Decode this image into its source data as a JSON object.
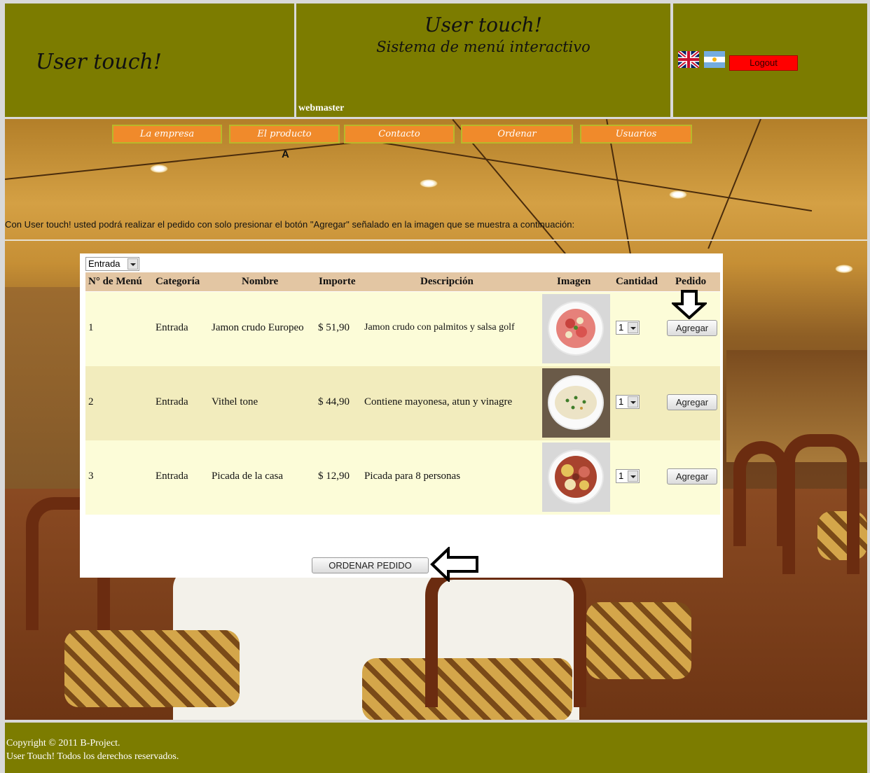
{
  "header": {
    "logo_text": "User touch!",
    "title": "User touch!",
    "subtitle": "Sistema de menú interactivo",
    "username": "webmaster",
    "logout_label": "Logout",
    "languages": [
      "english-flag-icon",
      "argentina-flag-icon"
    ]
  },
  "nav": {
    "items": [
      {
        "label": "La empresa"
      },
      {
        "label": "El producto"
      },
      {
        "label": "Contacto"
      },
      {
        "label": "Ordenar"
      },
      {
        "label": "Usuarios"
      }
    ],
    "marker": "A"
  },
  "intro": "Con User touch! usted podrá realizar el pedido con solo presionar el botón \"Agregar\" señalado en la imagen que se muestra a continuación:",
  "menu": {
    "category_select": "Entrada",
    "columns": [
      "N° de Menú",
      "Categoría",
      "Nombre",
      "Importe",
      "Descripción",
      "Imagen",
      "Cantidad",
      "Pedido"
    ],
    "rows": [
      {
        "num": "1",
        "category": "Entrada",
        "name": "Jamon crudo Europeo",
        "price": "$ 51,90",
        "description": "Jamon crudo con palmitos y salsa golf",
        "image": "jamon-crudo-plate-image",
        "quantity": "1",
        "action": "Agregar"
      },
      {
        "num": "2",
        "category": "Entrada",
        "name": "Vithel tone",
        "price": "$ 44,90",
        "description": "Contiene mayonesa, atun y vinagre",
        "image": "vithel-tone-plate-image",
        "quantity": "1",
        "action": "Agregar"
      },
      {
        "num": "3",
        "category": "Entrada",
        "name": "Picada de la casa",
        "price": "$ 12,90",
        "description": "Picada para 8 personas",
        "image": "picada-plate-image",
        "quantity": "1",
        "action": "Agregar"
      }
    ],
    "order_button": "ORDENAR PEDIDO"
  },
  "footer": {
    "line1": "Copyright © 2011 B-Project.",
    "line2": "User Touch! Todos los derechos reservados."
  },
  "colors": {
    "header_bg": "#7c7c00",
    "nav_bg": "#f08a2b",
    "nav_border": "#b8b82a",
    "logout_bg": "#ff0000",
    "table_header_bg": "#e3c6a3",
    "row_odd_bg": "#fcfcd8",
    "row_even_bg": "#f2ecbd"
  }
}
